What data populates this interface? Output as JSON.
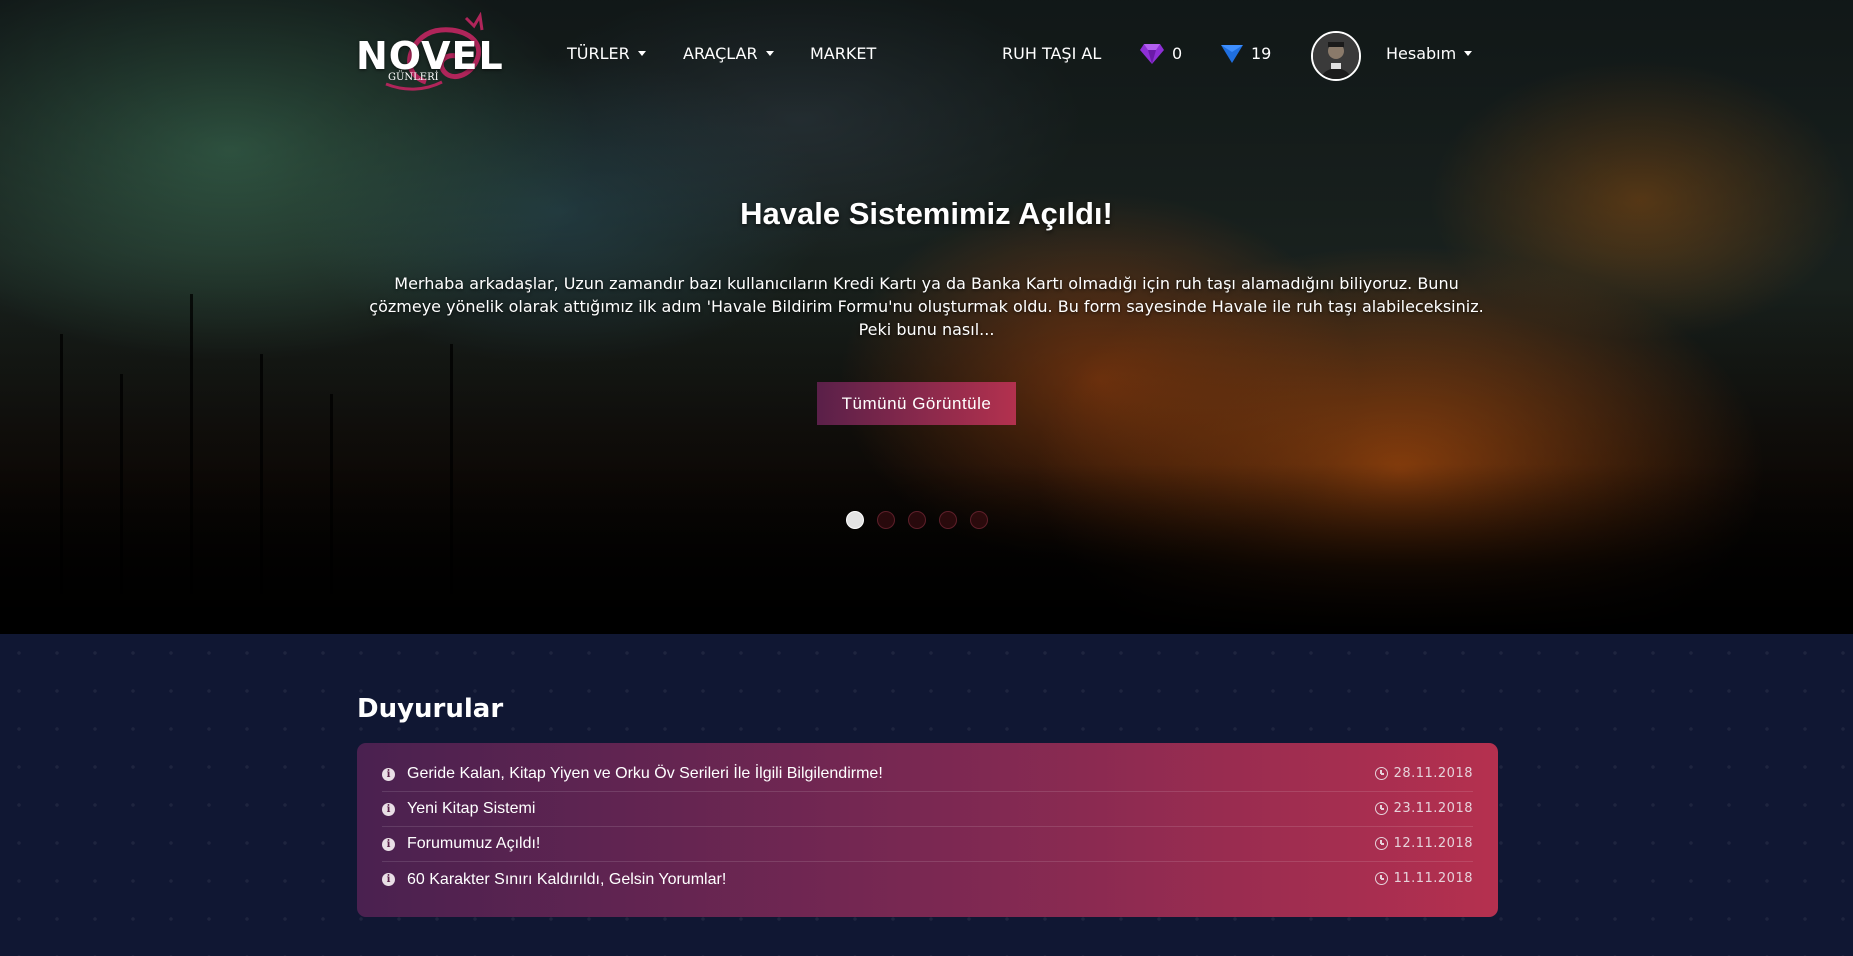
{
  "brand": {
    "logo_text": "NOVEL",
    "logo_sub": "GÜNLERİ",
    "accent": "#b5304f"
  },
  "nav": {
    "items": [
      {
        "label": "TÜRLER",
        "has_dropdown": true
      },
      {
        "label": "ARAÇLAR",
        "has_dropdown": true
      },
      {
        "label": "MARKET",
        "has_dropdown": false
      }
    ],
    "buy_label": "RUH TAŞI AL",
    "purple_gem_count": "0",
    "blue_gem_count": "19",
    "account_label": "Hesabım"
  },
  "hero": {
    "title": "Havale Sistemimiz Açıldı!",
    "text": "Merhaba arkadaşlar, Uzun zamandır bazı kullanıcıların Kredi Kartı ya da Banka Kartı olmadığı için ruh taşı alamadığını biliyoruz. Bunu çözmeye yönelik olarak attığımız ilk adım 'Havale Bildirim Formu'nu oluşturmak oldu. Bu form sayesinde Havale ile ruh taşı alabileceksiniz. Peki bunu nasıl...",
    "button_label": "Tümünü Görüntüle",
    "slide_count": 5,
    "active_slide": 0
  },
  "announcements": {
    "title": "Duyurular",
    "items": [
      {
        "title": "Geride Kalan, Kitap Yiyen ve Orku Öv Serileri İle İlgili Bilgilendirme!",
        "date": "28.11.2018"
      },
      {
        "title": "Yeni Kitap Sistemi",
        "date": "23.11.2018"
      },
      {
        "title": "Forumumuz Açıldı!",
        "date": "12.11.2018"
      },
      {
        "title": "60 Karakter Sınırı Kaldırıldı, Gelsin Yorumlar!",
        "date": "11.11.2018"
      }
    ]
  }
}
